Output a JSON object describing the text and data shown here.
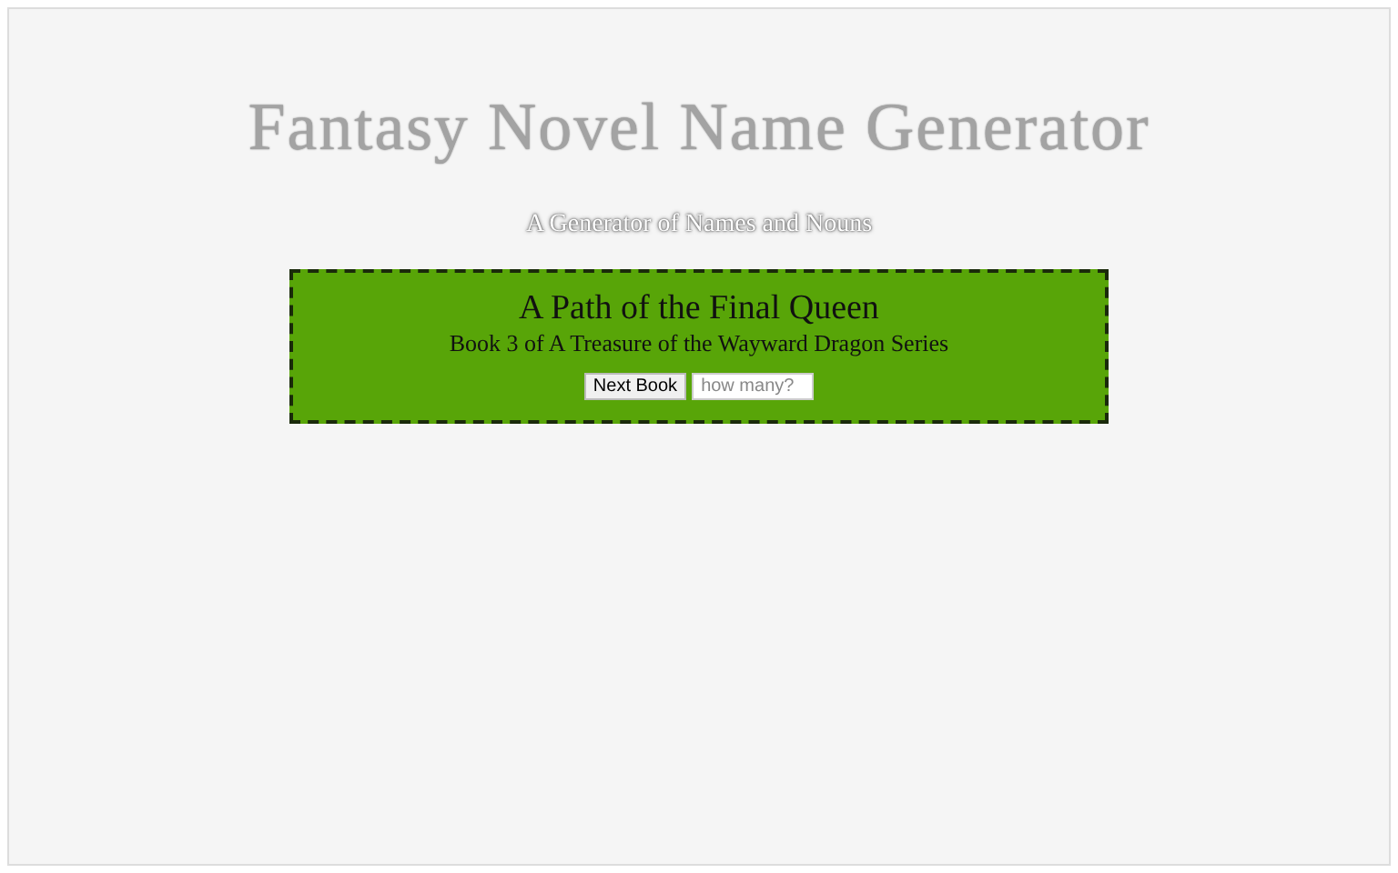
{
  "header": {
    "title": "Fantasy Novel Name Generator",
    "subtitle": "A Generator of Names and Nouns"
  },
  "result": {
    "book_title": "A Path of the Final Queen",
    "series_line": "Book 3 of A Treasure of the Wayward Dragon Series"
  },
  "controls": {
    "button": "Next Book",
    "count_field": {
      "placeholder": "how many?"
    }
  }
}
